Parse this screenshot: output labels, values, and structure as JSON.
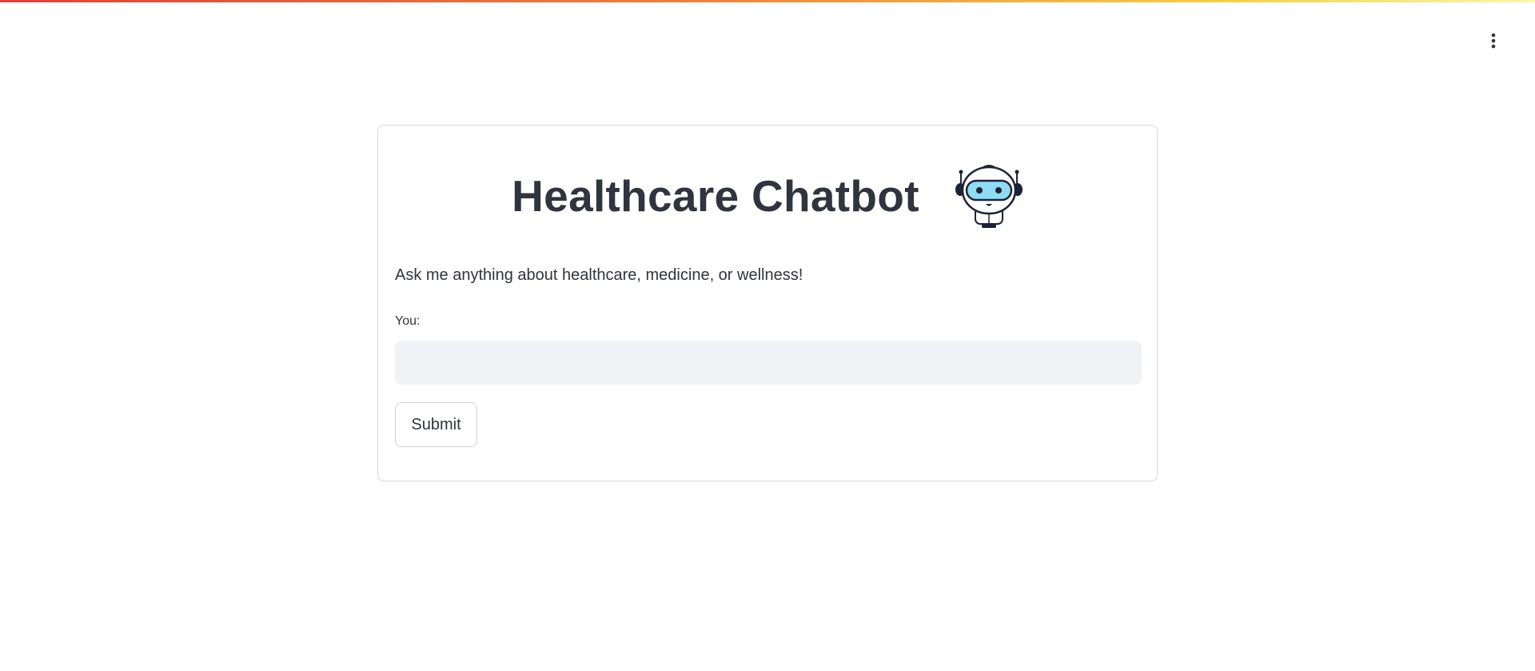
{
  "app": {
    "accent_gradient": [
      "#e0403a",
      "#f0803a",
      "#f6d040",
      "#fbf6a8"
    ],
    "menu_icon": "vertical-ellipsis-icon"
  },
  "card": {
    "title": "Healthcare Chatbot",
    "title_icon": "robot-icon",
    "subtitle": "Ask me anything about healthcare, medicine, or wellness!",
    "input_label": "You:",
    "input_value": "",
    "input_placeholder": "",
    "submit_label": "Submit"
  },
  "colors": {
    "text": "#31333f",
    "input_bg": "#f0f2f6",
    "border": "#d9d9de",
    "robot_visor": "#8fdcf4",
    "robot_dark": "#1e2235"
  }
}
